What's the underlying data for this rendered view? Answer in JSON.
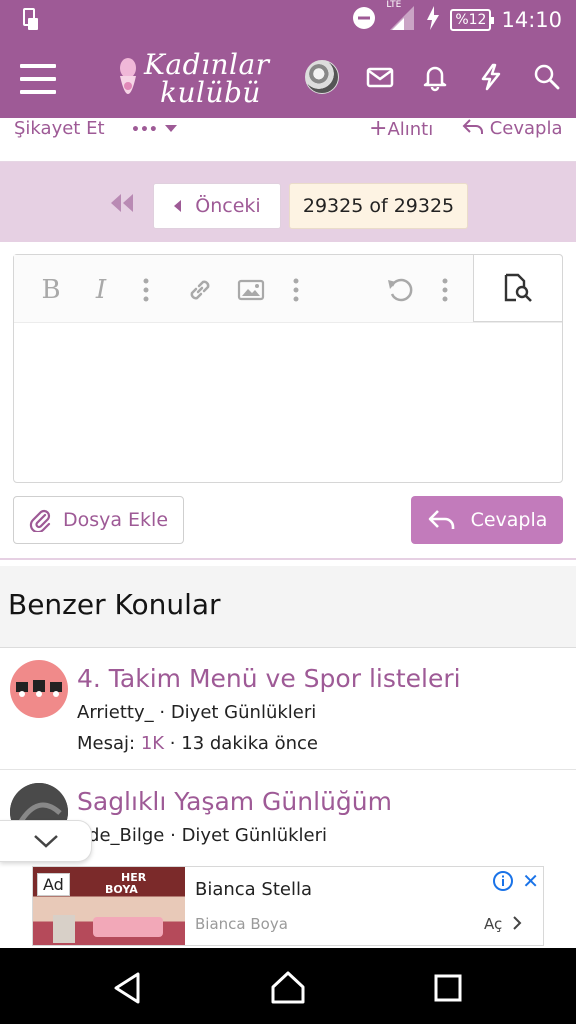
{
  "status_bar": {
    "time": "14:10",
    "battery": "%12",
    "network": "LTE",
    "icons": [
      "sim-icon",
      "dnd-icon",
      "signal-icon",
      "charging-icon"
    ]
  },
  "header": {
    "logo_line1": "Kadınlar",
    "logo_line2": "kulübü",
    "icons": [
      "menu-icon",
      "avatar",
      "mail-icon",
      "bell-icon",
      "lightning-icon",
      "search-icon"
    ]
  },
  "post_actions": {
    "report": "Şikayet Et",
    "more": "•••",
    "quote": "Alıntı",
    "reply": "Cevapla"
  },
  "pagination": {
    "prev_label": "Önceki",
    "current": "29325 of 29325"
  },
  "editor": {
    "toolbar": [
      "bold",
      "italic",
      "more",
      "link",
      "image",
      "more",
      "undo",
      "more",
      "preview"
    ],
    "bold_label": "B",
    "italic_label": "I",
    "attach_label": "Dosya Ekle",
    "reply_label": "Cevapla"
  },
  "similar": {
    "heading": "Benzer Konular",
    "threads": [
      {
        "title": "4. Takim Menü ve Spor listeleri",
        "author": "Arrietty_",
        "forum": "Diyet Günlükleri",
        "replies_label": "Mesaj:",
        "replies": "1K",
        "time": "13 dakika önce"
      },
      {
        "title": "Saglıklı Yaşam Günlüğüm",
        "author": "ade_Bilge",
        "forum": "Diyet Günlükleri"
      }
    ]
  },
  "ad": {
    "badge": "Ad",
    "brand1": "HER",
    "brand2": "BOYA",
    "title": "Bianca Stella",
    "subtitle": "Bianca Boya",
    "open_label": "Aç"
  },
  "colors": {
    "brand": "#9e5a96",
    "accent_button": "#c27bbb",
    "pagination_bg": "#e6d0e3",
    "page_highlight": "#fdf3e3"
  }
}
